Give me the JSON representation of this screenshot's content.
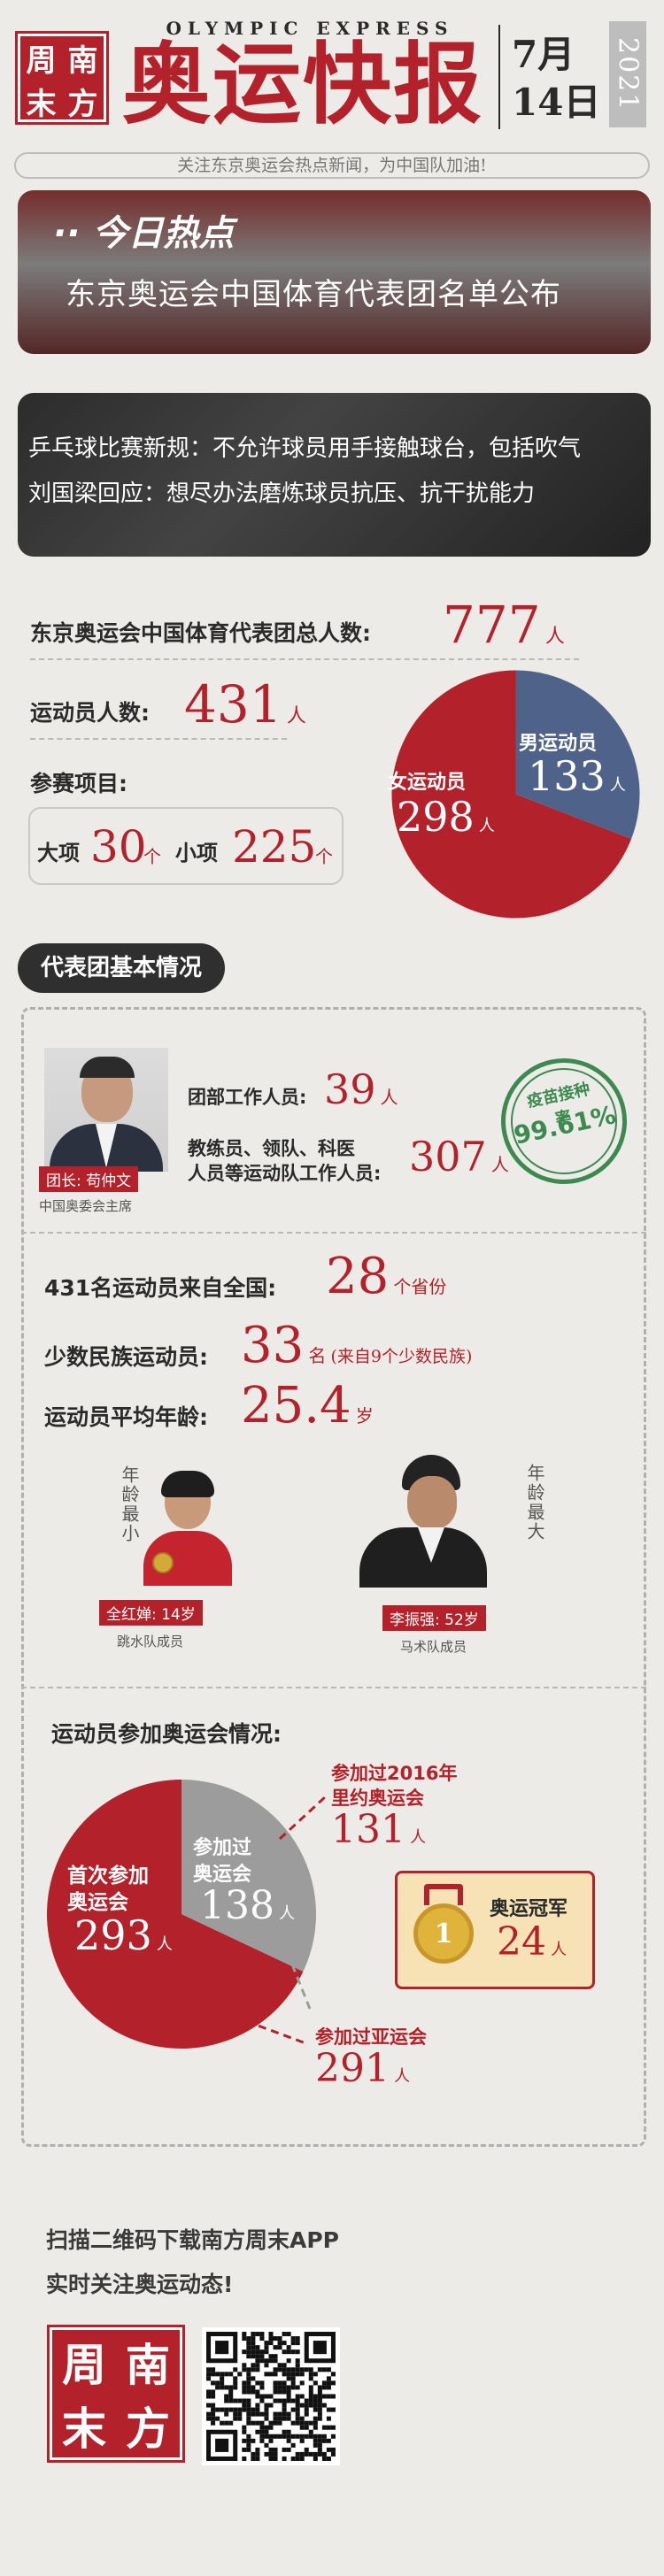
{
  "header": {
    "logo_chars": [
      "周",
      "南",
      "末",
      "方"
    ],
    "english_title": "OLYMPIC EXPRESS",
    "title": "奥运快报",
    "date_month": "7月",
    "date_day": "14日",
    "year": "2021",
    "tagline": "关注东京奥运会热点新闻，为中国队加油!"
  },
  "hot_news": {
    "badge": "今日热点",
    "headline": "东京奥运会中国体育代表团名单公布"
  },
  "news2": {
    "line1": "乒乓球比赛新规：不允许球员用手接触球台，包括吹气",
    "line2": "刘国梁回应：想尽办法磨炼球员抗压、抗干扰能力"
  },
  "stats": {
    "total_label": "东京奥运会中国体育代表团总人数:",
    "total_value": "777",
    "total_unit": "人",
    "athletes_label": "运动员人数:",
    "athletes_value": "431",
    "athletes_unit": "人",
    "events_label": "参赛项目:",
    "major_label": "大项",
    "major_value": "30",
    "major_unit": "个",
    "minor_label": "小项",
    "minor_value": "225",
    "minor_unit": "个"
  },
  "gender_pie": {
    "female_label": "女运动员",
    "female_value": "298",
    "female_unit": "人",
    "male_label": "男运动员",
    "male_value": "133",
    "male_unit": "人",
    "female_color": "#b3212b",
    "male_color": "#4f6289"
  },
  "section_title": "代表团基本情况",
  "leader": {
    "tag": "团长: 苟仲文",
    "caption": "中国奥委会主席",
    "staff_label": "团部工作人员:",
    "staff_value": "39",
    "staff_unit": "人",
    "coaches_label_1": "教练员、领队、科医",
    "coaches_label_2": "人员等运动队工作人员:",
    "coaches_value": "307",
    "coaches_unit": "人",
    "vaccine_label": "疫苗接种率",
    "vaccine_value": "99.61%"
  },
  "origin": {
    "provinces_label": "431名运动员来自全国:",
    "provinces_value": "28",
    "provinces_unit": "个省份",
    "minority_label": "少数民族运动员:",
    "minority_value": "33",
    "minority_unit": "名",
    "minority_note": "(来自9个少数民族)",
    "age_label": "运动员平均年龄:",
    "age_value": "25.4",
    "age_unit": "岁"
  },
  "youngest": {
    "vertical": "年龄最小",
    "tag": "全红婵: 14岁",
    "caption": "跳水队成员"
  },
  "oldest": {
    "vertical": "年龄最大",
    "tag": "李振强: 52岁",
    "caption": "马术队成员"
  },
  "participation": {
    "title": "运动员参加奥运会情况:",
    "first_label_1": "首次参加",
    "first_label_2": "奥运会",
    "first_value": "293",
    "first_unit": "人",
    "prev_label_1": "参加过",
    "prev_label_2": "奥运会",
    "prev_value": "138",
    "prev_unit": "人",
    "rio_label_1": "参加过2016年",
    "rio_label_2": "里约奥运会",
    "rio_value": "131",
    "rio_unit": "人",
    "asian_label": "参加过亚运会",
    "asian_value": "291",
    "asian_unit": "人",
    "champion_label": "奥运冠军",
    "champion_value": "24",
    "champion_unit": "人",
    "first_color": "#b3212b",
    "prev_color": "#9c9c9c"
  },
  "footer": {
    "line1": "扫描二维码下载南方周末APP",
    "line2": "实时关注奥运动态!",
    "logo_chars": [
      "周",
      "南",
      "末",
      "方"
    ]
  }
}
